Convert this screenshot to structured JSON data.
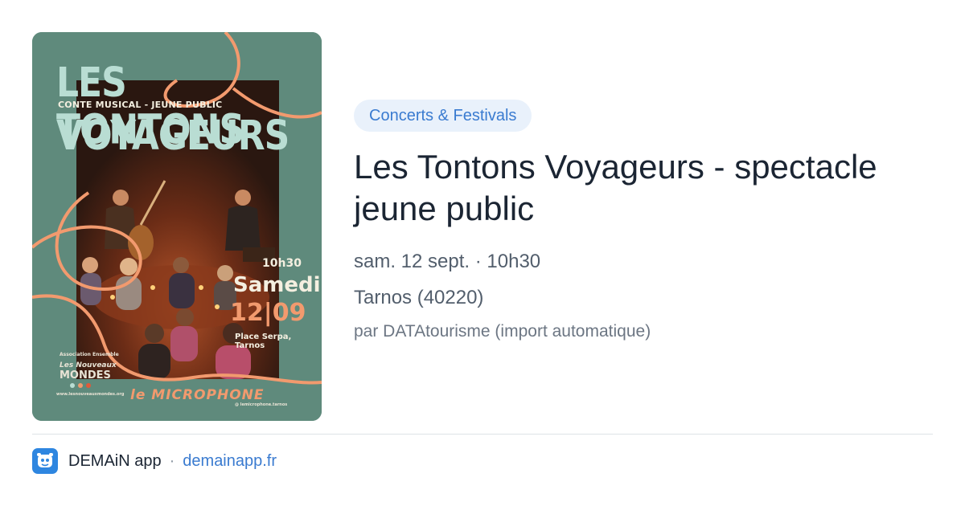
{
  "poster": {
    "title_line1": "LES TONTONS",
    "subtitle": "CONTE MUSICAL - JEUNE PUBLIC",
    "title_line2": "VOYAGEURS",
    "time": "10h30",
    "day": "Samedi",
    "date": "12|09",
    "place": "Place Serpa, Tarnos",
    "assoc_small": "Association Ensemble",
    "assoc_script": "Les Nouveaux",
    "assoc_name": "MONDES",
    "sponsor": "le MICROPHONE",
    "contact": "www.lesnouveauxmondes.org",
    "handle": "@ lemicrophone.tarnos"
  },
  "event": {
    "category": "Concerts & Festivals",
    "title": "Les Tontons Voyageurs - spectacle jeune public",
    "datetime": "sam. 12 sept. · 10h30",
    "location": "Tarnos (40220)",
    "source": "par DATAtourisme (import automatique)"
  },
  "footer": {
    "app_name": "DEMAiN app",
    "separator": "·",
    "domain": "demainapp.fr",
    "icon": "app-logo-icon"
  },
  "colors": {
    "poster_bg": "#5f8a7c",
    "accent_orange": "#f29a6e",
    "badge_bg": "#e9f1fb",
    "link_blue": "#3a7bd0",
    "title_text": "#1b2533"
  }
}
